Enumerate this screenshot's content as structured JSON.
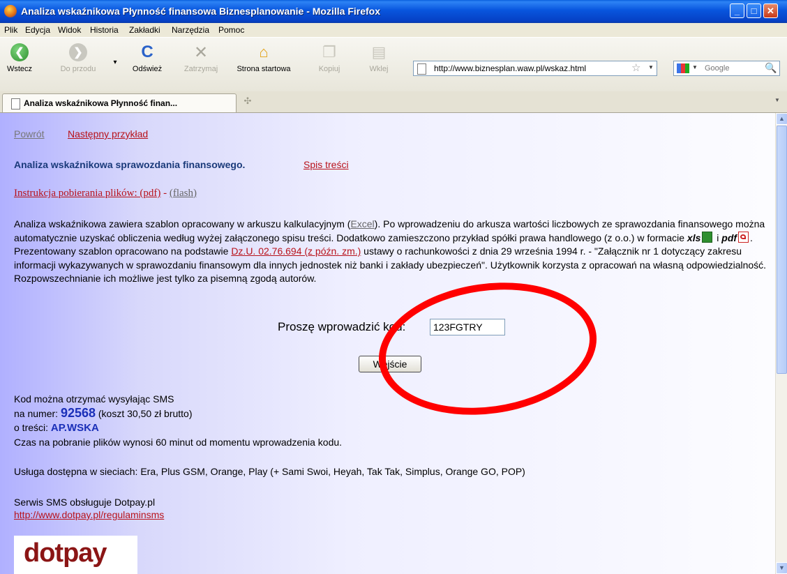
{
  "window": {
    "title": "Analiza wskaźnikowa Płynność finansowa Biznesplanowanie - Mozilla Firefox"
  },
  "menu": [
    "Plik",
    "Edycja",
    "Widok",
    "Historia",
    "Zakładki",
    "Narzędzia",
    "Pomoc"
  ],
  "toolbar": {
    "back": "Wstecz",
    "forward": "Do przodu",
    "reload": "Odśwież",
    "stop": "Zatrzymaj",
    "home": "Strona startowa",
    "copy": "Kopiuj",
    "paste": "Wklej",
    "url": "http://www.biznesplan.waw.pl/wskaz.html",
    "search_placeholder": "Google"
  },
  "tabs": [
    {
      "label": "Analiza wskaźnikowa Płynność finan..."
    }
  ],
  "content": {
    "nav_back": "Powrót",
    "nav_next": "Następny przykład",
    "heading": "Analiza wskaźnikowa sprawozdania finansowego.",
    "toc_link": "Spis treści",
    "instruction_link": "Instrukcja pobierania plików: (pdf)",
    "instruction_sep": " - ",
    "flash_link": "(flash)",
    "para_1": "Analiza wskaźnikowa zawiera szablon opracowany w arkuszu kalkulacyjnym (",
    "excel_link": "Excel",
    "para_2": "). Po wprowadzeniu do arkusza wartości liczbowych ze sprawozdania finansowego można automatycznie uzyskać obliczenia według wyżej załączonego spisu treści. Dodatkowo zamieszczono przykład spółki prawa handlowego (z o.o.) w formacie ",
    "xls": "xls",
    "and": " i ",
    "pdf": "pdf",
    "para_3": ". Prezentowany szablon opracowano na podstawie ",
    "law_link": "Dz.U. 02.76.694 (z późn. zm.)",
    "para_4": " ustawy o rachunkowości z dnia 29 września 1994 r. - \"Załącznik nr 1 dotyczący zakresu informacji wykazywanych w sprawozdaniu finansowym dla innych jednostek niż banki i zakłady ubezpieczeń\". Użytkownik korzysta z opracowań na własną odpowiedzialność. Rozpowszechnianie ich możliwe jest tylko za pisemną zgodą autorów.",
    "code_label": "Proszę  wprowadzić kod:",
    "code_value": "123FGTRY",
    "enter_button": "Wejście",
    "sms_line1": "Kod można otrzymać wysyłając SMS",
    "sms_number_prefix": "na numer: ",
    "sms_number": "92568",
    "sms_cost": " (koszt 30,50 zł brutto)",
    "sms_text_prefix": "o treści: ",
    "sms_keyword": "AP.WSKA",
    "time_info": "Czas na pobranie plików wynosi 60 minut od momentu wprowadzenia kodu.",
    "networks": "Usługa dostępna w sieciach: Era, Plus GSM, Orange, Play (+ Sami Swoi, Heyah, Tak Tak, Simplus, Orange GO, POP)",
    "service_by": "Serwis SMS obsługuje Dotpay.pl",
    "rules_link": "http://www.dotpay.pl/regulaminsms",
    "logo_text": "dotpay"
  },
  "colors": {
    "annotation": "#ff0000",
    "link": "#b8121a",
    "highlight_blue": "#1a2fb8"
  }
}
